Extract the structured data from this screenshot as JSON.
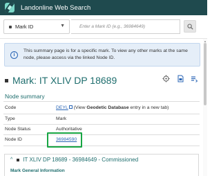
{
  "app": {
    "title": "Landonline Web Search",
    "logo": "landonline-logo"
  },
  "search": {
    "type_selected": "Mark ID",
    "placeholder": "Enter a Mark ID (e.g., 36984649)",
    "button_icon": "search-icon"
  },
  "info_banner": {
    "icon": "info-icon",
    "text": "This summary page is for a specific mark. To view any other marks at the same node, please access via the linked Node ID."
  },
  "mark": {
    "title": "Mark: IT XLIV DP 18689",
    "actions": [
      "crosshair-icon",
      "export-icon",
      "list-icon"
    ]
  },
  "node_summary": {
    "heading": "Node summary",
    "rows": {
      "code": {
        "label": "Code",
        "link": "DEYL",
        "pre": "(View",
        "bold": "Geodetic Database",
        "post": "entry in a new tab)"
      },
      "type": {
        "label": "Type",
        "value": "Mark"
      },
      "status": {
        "label": "Node Status",
        "value": "Authoritative"
      },
      "node_id": {
        "label": "Node ID",
        "value": "36984590"
      }
    }
  },
  "accordion": {
    "title": "IT XLIV DP 18689 - 36984649 - Commissioned",
    "sub": "Mark General Information"
  },
  "colors": {
    "topbar": "#1f4a4e",
    "accent": "#1f6e6e",
    "link": "#2a65b5",
    "highlight": "#17a543",
    "info_bg": "#e5eef8"
  }
}
